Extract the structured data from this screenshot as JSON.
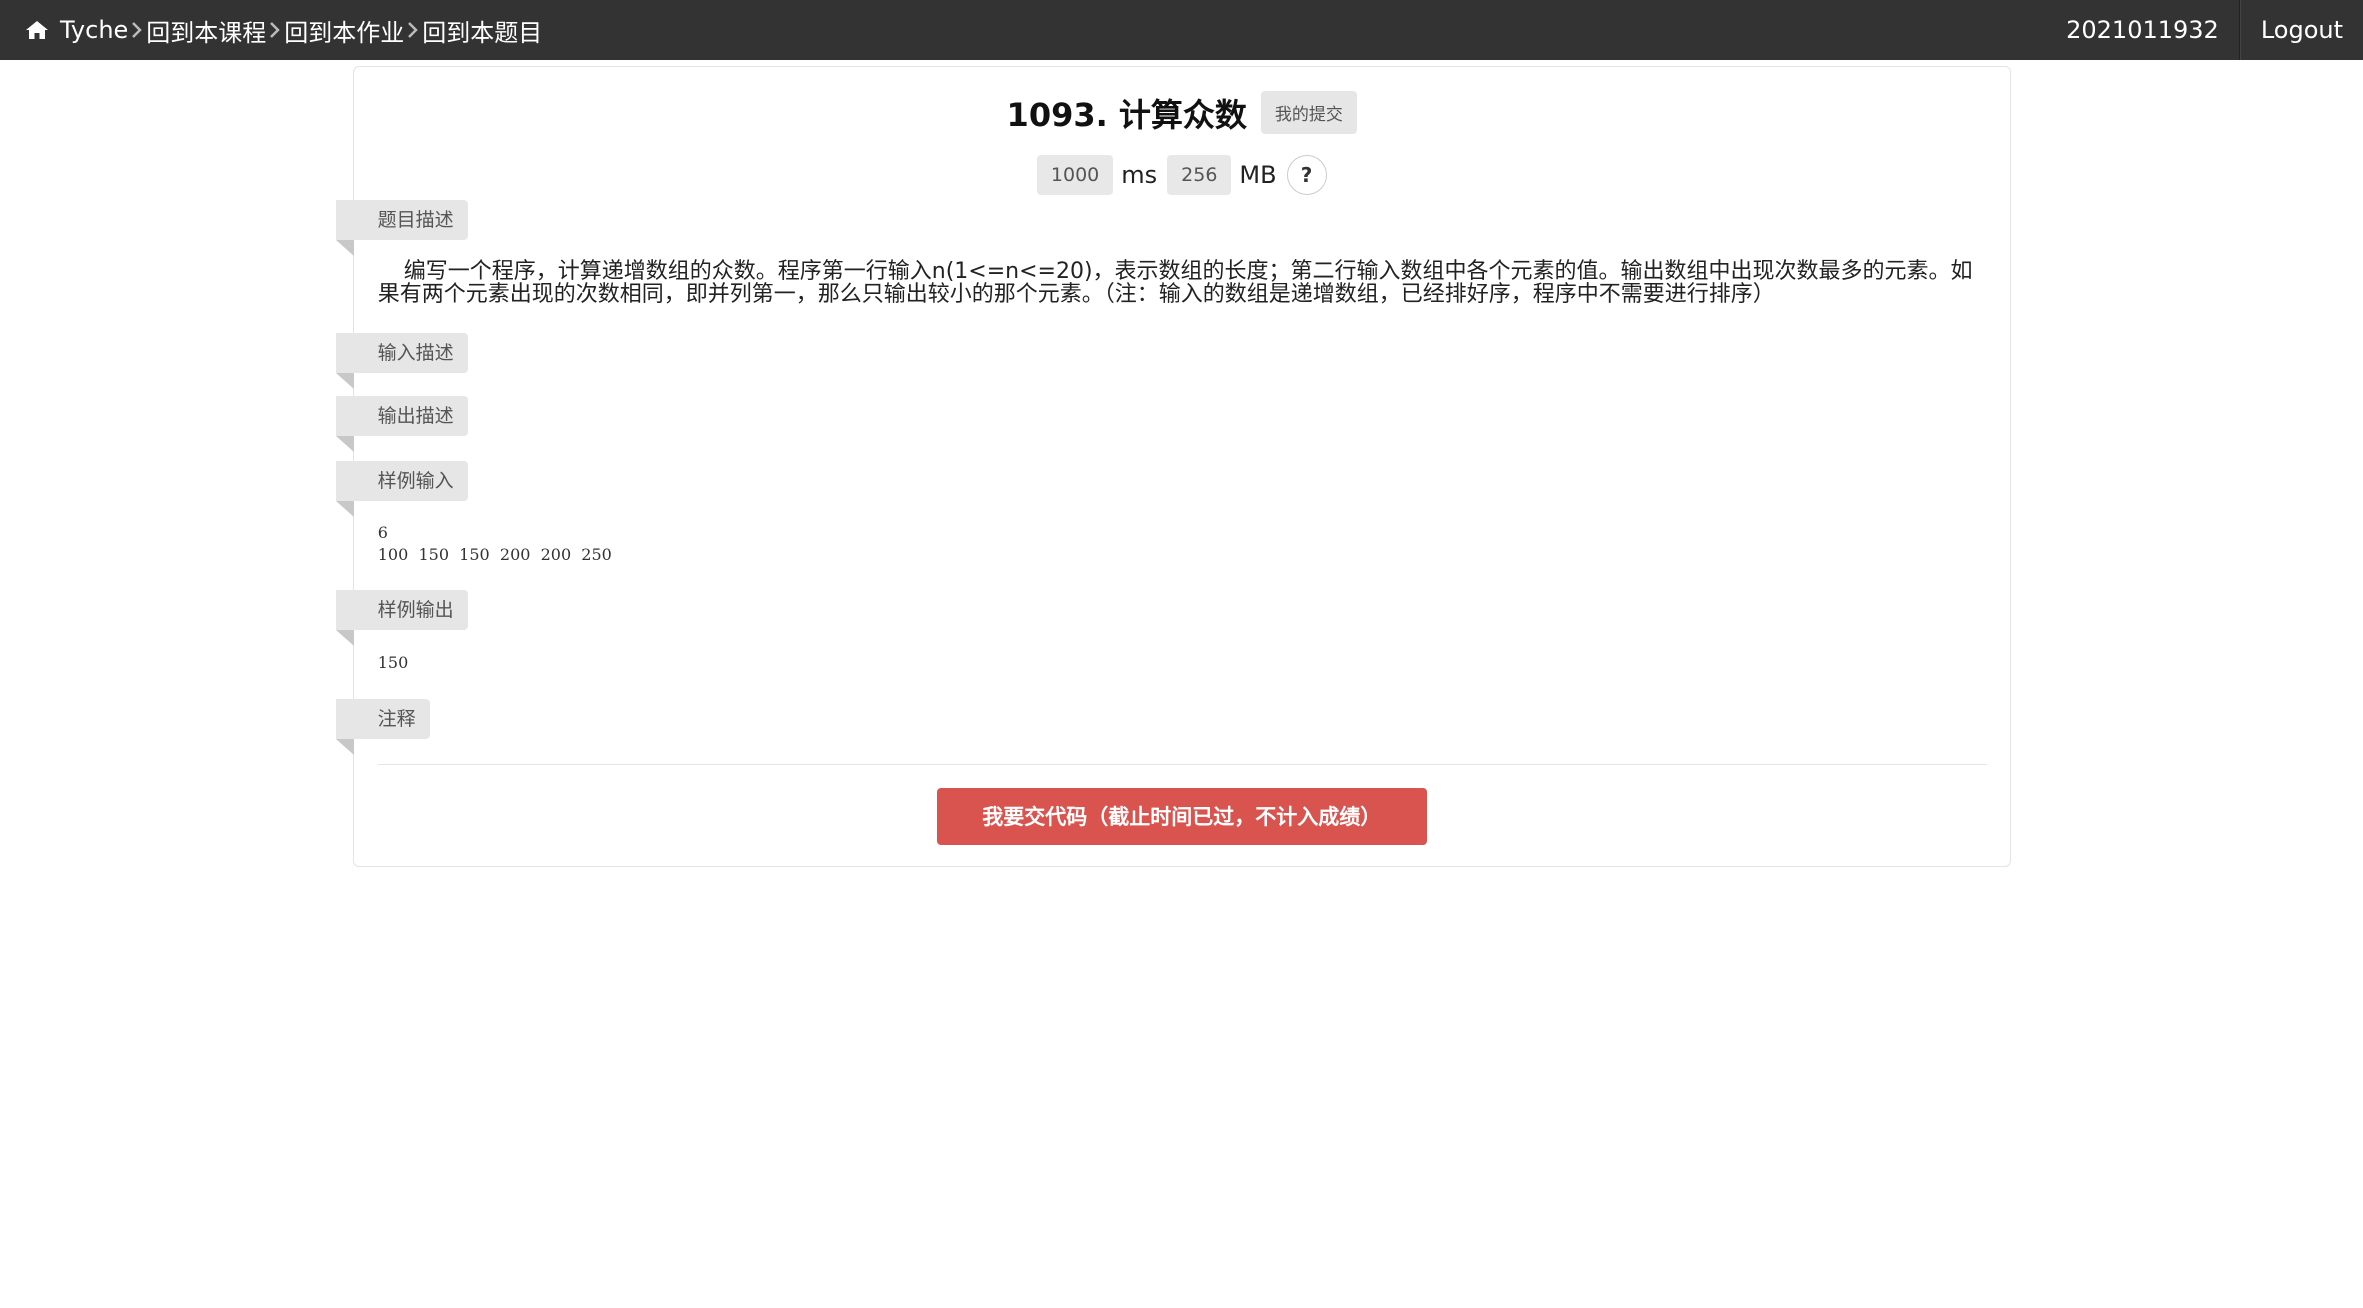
{
  "navbar": {
    "brand": "Tyche",
    "breadcrumbs": [
      "回到本课程",
      "回到本作业",
      "回到本题目"
    ],
    "user": "2021011932",
    "logout": "Logout"
  },
  "problem": {
    "title": "1093. 计算众数",
    "my_submissions": "我的提交",
    "time_limit": "1000",
    "time_unit": "ms",
    "memory_limit": "256",
    "memory_unit": "MB",
    "help": "?"
  },
  "sections": {
    "description_label": "题目描述",
    "description_line1": "编写一个程序，计算递增数组的众数。程序第一行输入n(1<=n<=20)，表示数组的长度；第二行输入数组中各个元素的值。输出数组中出现次数最多的元素。如",
    "description_line2": "果有两个元素出现的次数相同，即并列第一，那么只输出较小的那个元素。（注：输入的数组是递增数组，已经排好序，程序中不需要进行排序）",
    "input_label": "输入描述",
    "output_label": "输出描述",
    "sample_input_label": "样例输入",
    "sample_input": "6\n100  150  150  200  200  250",
    "sample_output_label": "样例输出",
    "sample_output": "150",
    "notes_label": "注释"
  },
  "submit_button": "我要交代码（截止时间已过，不计入成绩）",
  "colors": {
    "navbar_bg": "#333333",
    "submit_bg": "#d9534f",
    "ribbon_bg": "#e6e6e6"
  }
}
